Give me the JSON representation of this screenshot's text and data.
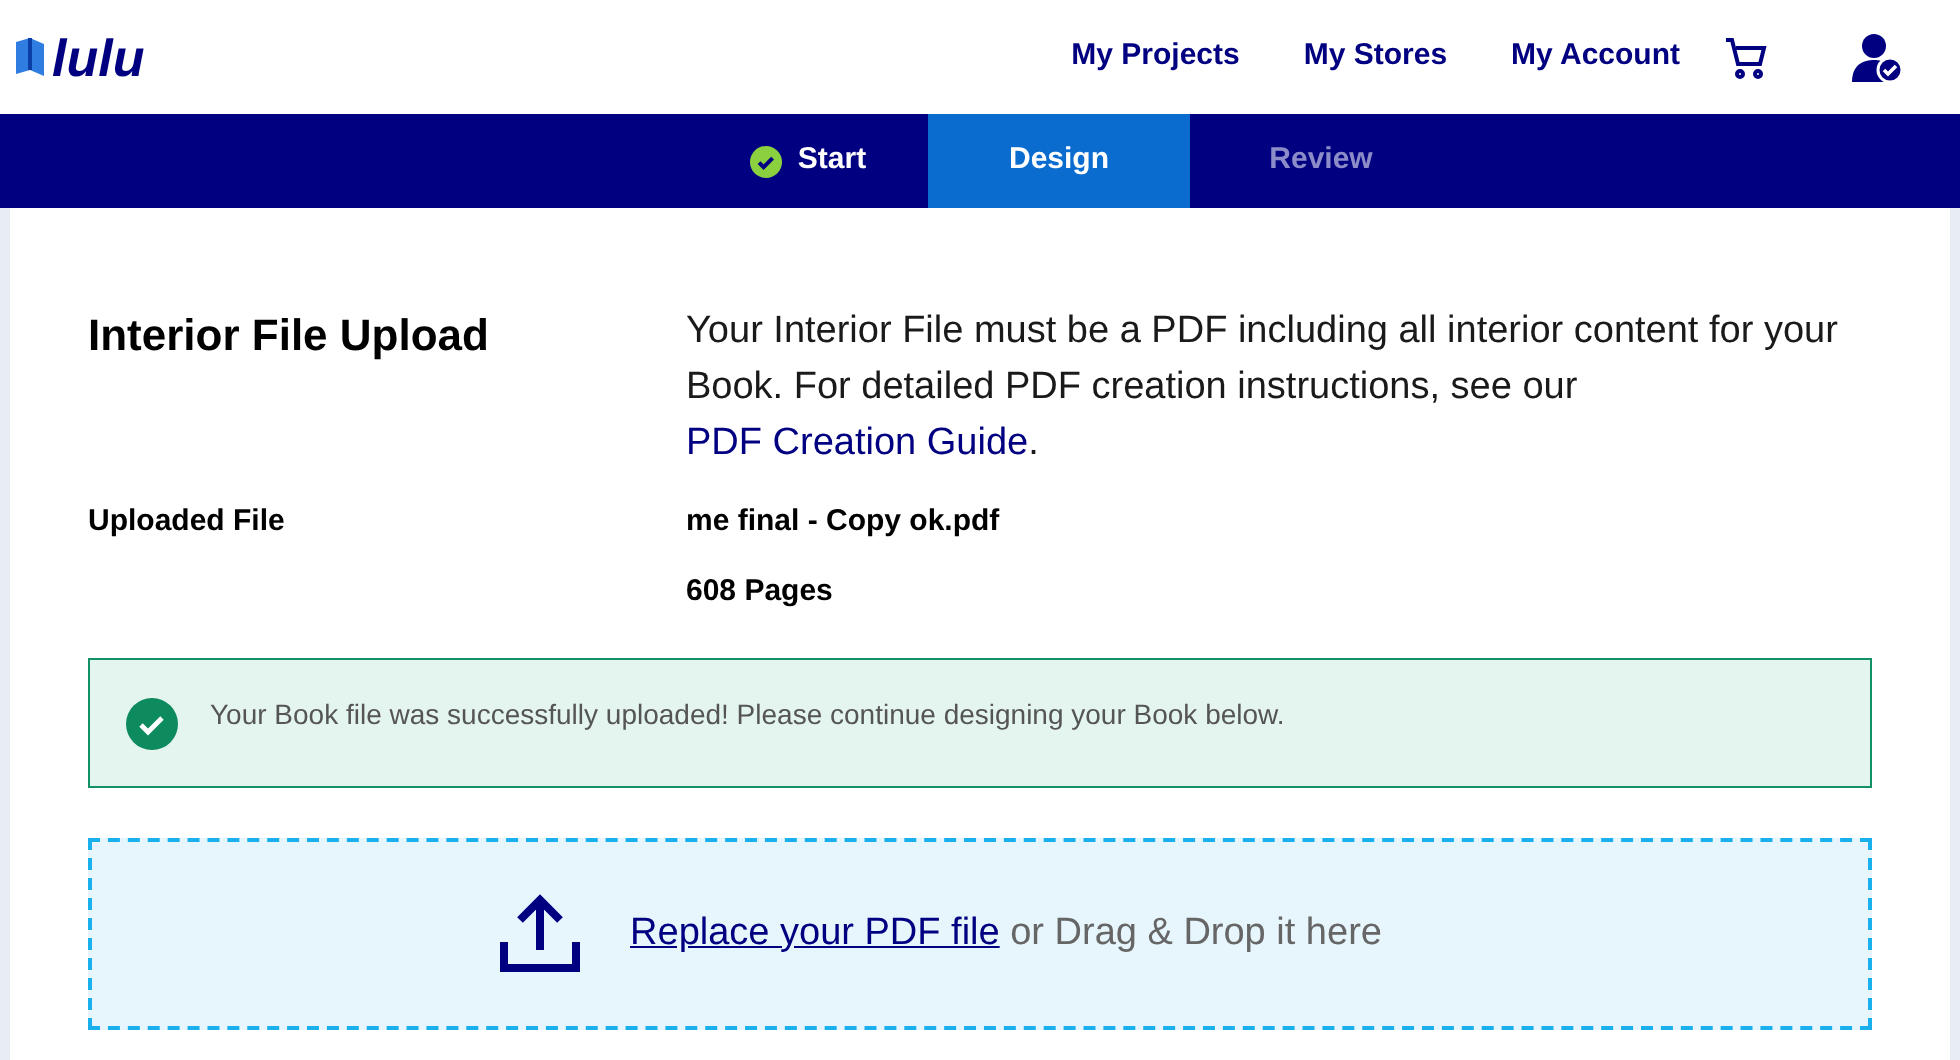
{
  "header": {
    "logo": "lulu",
    "nav": [
      "My Projects",
      "My Stores",
      "My Account"
    ]
  },
  "steps": [
    {
      "label": "Start",
      "selected": false,
      "completed": true
    },
    {
      "label": "Design",
      "selected": true,
      "completed": false
    },
    {
      "label": "Review",
      "selected": false,
      "completed": false
    }
  ],
  "section": {
    "title": "Interior File Upload",
    "description": {
      "before": "Your Interior File must be a PDF including all interior content for your Book. For detailed PDF creation instructions, see our ",
      "link": "PDF Creation Guide",
      "after": "."
    }
  },
  "uploaded_file": {
    "label": "Uploaded File",
    "name": "me final - Copy ok.pdf",
    "pages": "608 Pages"
  },
  "alert": {
    "message": "Your Book file was successfully uploaded! Please continue designing your Book below."
  },
  "dropzone": {
    "link": "Replace your PDF file",
    "text": "or Drag & Drop it here"
  }
}
